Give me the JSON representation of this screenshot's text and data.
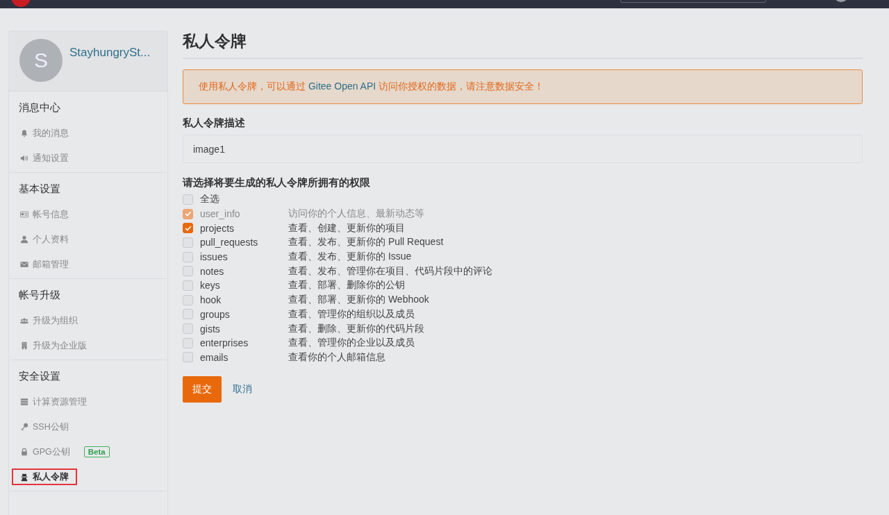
{
  "sidebar": {
    "profile": {
      "avatar_letter": "S",
      "username": "StayhungrySt..."
    },
    "sections": [
      {
        "title": "消息中心",
        "items": [
          {
            "label": "我的消息",
            "selected": false
          },
          {
            "label": "通知设置",
            "selected": false
          }
        ]
      },
      {
        "title": "基本设置",
        "items": [
          {
            "label": "帐号信息",
            "selected": false
          },
          {
            "label": "个人资料",
            "selected": false
          },
          {
            "label": "邮箱管理",
            "selected": false
          }
        ]
      },
      {
        "title": "帐号升级",
        "items": [
          {
            "label": "升级为组织",
            "selected": false
          },
          {
            "label": "升级为企业版",
            "selected": false
          }
        ]
      },
      {
        "title": "安全设置",
        "items": [
          {
            "label": "计算资源管理",
            "selected": false
          },
          {
            "label": "SSH公钥",
            "selected": false
          },
          {
            "label": "GPG公钥",
            "badge": "Beta",
            "selected": false
          },
          {
            "label": "私人令牌",
            "selected": true
          }
        ]
      }
    ]
  },
  "main": {
    "title": "私人令牌",
    "notice": {
      "before": "使用私人令牌，可以通过 ",
      "link": "Gitee Open API",
      "after": " 访问你授权的数据，请注意数据安全！"
    },
    "description_label": "私人令牌描述",
    "description_value": "image1",
    "permissions_label": "请选择将要生成的私人令牌所拥有的权限",
    "select_all": {
      "label": "全选",
      "checked": false
    },
    "permissions": [
      {
        "name": "user_info",
        "description": "访问你的个人信息、最新动态等",
        "checked": true,
        "disabled": true
      },
      {
        "name": "projects",
        "description": "查看、创建、更新你的项目",
        "checked": true,
        "disabled": false
      },
      {
        "name": "pull_requests",
        "description": "查看、发布、更新你的 Pull Request",
        "checked": false,
        "disabled": false
      },
      {
        "name": "issues",
        "description": "查看、发布、更新你的 Issue",
        "checked": false,
        "disabled": false
      },
      {
        "name": "notes",
        "description": "查看、发布、管理你在项目、代码片段中的评论",
        "checked": false,
        "disabled": false
      },
      {
        "name": "keys",
        "description": "查看、部署、删除你的公钥",
        "checked": false,
        "disabled": false
      },
      {
        "name": "hook",
        "description": "查看、部署、更新你的 Webhook",
        "checked": false,
        "disabled": false
      },
      {
        "name": "groups",
        "description": "查看、管理你的组织以及成员",
        "checked": false,
        "disabled": false
      },
      {
        "name": "gists",
        "description": "查看、删除、更新你的代码片段",
        "checked": false,
        "disabled": false
      },
      {
        "name": "enterprises",
        "description": "查看、管理你的企业以及成员",
        "checked": false,
        "disabled": false
      },
      {
        "name": "emails",
        "description": "查看你的个人邮箱信息",
        "checked": false,
        "disabled": false
      }
    ],
    "submit": "提交",
    "cancel": "取消"
  }
}
